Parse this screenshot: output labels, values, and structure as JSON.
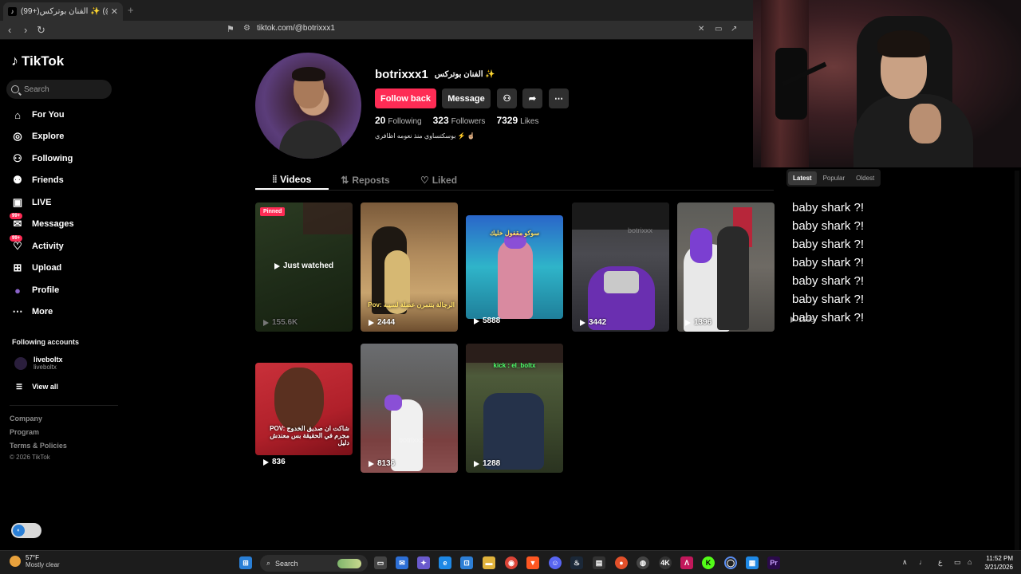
{
  "browser": {
    "tab_title": "(99+)الفنان بوتركس ✨ (@botrixxx1",
    "tab_close": "✕",
    "new_tab": "+",
    "url": "tiktok.com/@botrixxx1"
  },
  "sidebar": {
    "logo": "TikTok",
    "search_placeholder": "Search",
    "items": [
      {
        "label": "For You",
        "icon": "home-icon",
        "glyph": "⌂"
      },
      {
        "label": "Explore",
        "icon": "compass-icon",
        "glyph": "◎"
      },
      {
        "label": "Following",
        "icon": "following-icon",
        "glyph": "⚇"
      },
      {
        "label": "Friends",
        "icon": "friends-icon",
        "glyph": "⚉"
      },
      {
        "label": "LIVE",
        "icon": "live-icon",
        "glyph": "▣"
      },
      {
        "label": "Messages",
        "icon": "messages-icon",
        "glyph": "✉",
        "badge": "99+"
      },
      {
        "label": "Activity",
        "icon": "activity-icon",
        "glyph": "♡",
        "badge": "99+"
      },
      {
        "label": "Upload",
        "icon": "upload-icon",
        "glyph": "⊞"
      },
      {
        "label": "Profile",
        "icon": "profile-icon",
        "glyph": "●"
      },
      {
        "label": "More",
        "icon": "more-icon",
        "glyph": "⋯"
      }
    ],
    "following_accounts_title": "Following accounts",
    "account": {
      "name": "liveboltx",
      "handle": "liveboltx"
    },
    "view_all": "View all",
    "footer": [
      "Company",
      "Program",
      "Terms & Policies"
    ],
    "copyright": "© 2026 TikTok"
  },
  "profile": {
    "username": "botrixxx1",
    "nickname": "الفنان بوتركس ✨",
    "follow_back": "Follow back",
    "message": "Message",
    "following_count": "20",
    "following_label": "Following",
    "followers_count": "323",
    "followers_label": "Followers",
    "likes_count": "7329",
    "likes_label": "Likes",
    "bio": "بوسكتساوي منذ نعومه اظافري ⚡ ☝🏼"
  },
  "tabs": {
    "videos": "Videos",
    "reposts": "Reposts",
    "liked": "Liked"
  },
  "sort": {
    "latest": "Latest",
    "popular": "Popular",
    "oldest": "Oldest"
  },
  "videos": [
    {
      "views": "155.6K",
      "pinned": "Pinned",
      "overlay": "Just watched"
    },
    {
      "views": "2444",
      "caption": "Pov: الرجالة بتتمرن عضلة لسيبه"
    },
    {
      "views": "5888",
      "caption": "سوكو مقفول خليك"
    },
    {
      "views": "3442"
    },
    {
      "views": "1396"
    },
    {
      "views": "836",
      "caption": "POV: شاكت ان صديق الخدوج مجرم في الحقيقة بس معندش دليل"
    },
    {
      "views": "8136"
    },
    {
      "views": "1288",
      "caption": "kick : el_boltx"
    }
  ],
  "overlay_lines": [
    "baby shark ?!",
    "baby shark ?!",
    "baby shark ?!",
    "baby shark ?!",
    "baby shark ?!",
    "baby shark ?!",
    "baby shark ?!"
  ],
  "overlay_ghost_views": "1538",
  "taskbar": {
    "temp": "57°F",
    "weather": "Mostly clear",
    "search": "Search",
    "time": "11:52 PM",
    "date": "3/21/2026",
    "lang": "ع"
  }
}
